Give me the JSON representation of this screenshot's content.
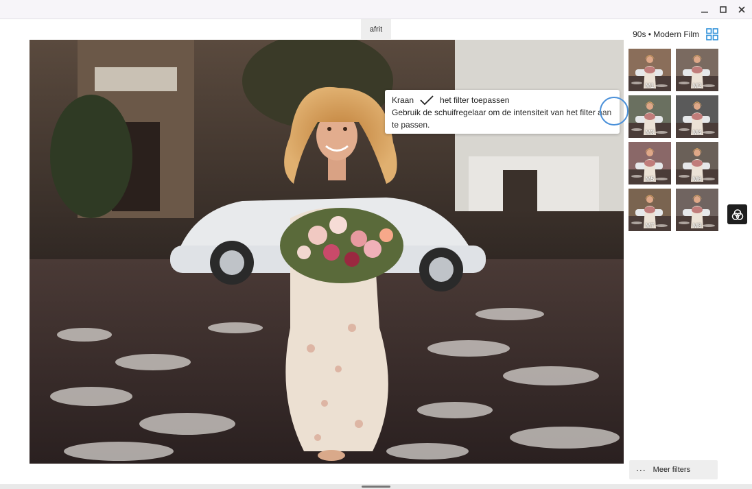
{
  "window": {
    "minimize_glyph": "–",
    "maximize_glyph": "□",
    "close_glyph": "✕"
  },
  "toolbar": {
    "cancel_label": "afrit"
  },
  "tooltip": {
    "tap_word": "Kraan",
    "apply_text": "het filter toepassen",
    "hint": "Gebruik de schuifregelaar om de intensiteit van het filter aan te passen."
  },
  "panel": {
    "title": "90s • Modern Film",
    "grid_icon": "grid-view-icon",
    "accent_color": "#2c8fd9"
  },
  "filters": [
    {
      "label": "M1"
    },
    {
      "label": "M2"
    },
    {
      "label": "M3"
    },
    {
      "label": "M4"
    },
    {
      "label": "M5"
    },
    {
      "label": "M6"
    },
    {
      "label": "M7"
    },
    {
      "label": "M8"
    }
  ],
  "side_tool": {
    "icon": "filter-circles-icon"
  },
  "more_filters": {
    "label": "Meer filters",
    "icon": "more-dots-icon"
  }
}
